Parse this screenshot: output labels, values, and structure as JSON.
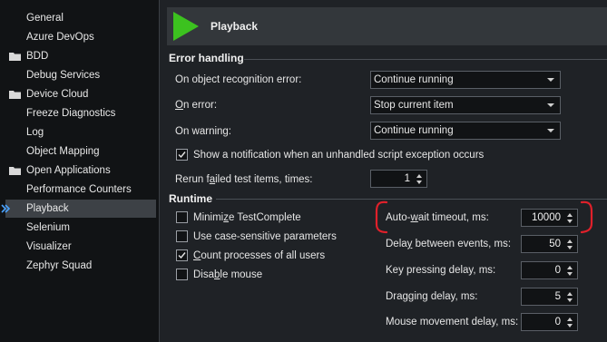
{
  "sidebar": {
    "items": [
      {
        "label": "General",
        "folder": false,
        "selected": false
      },
      {
        "label": "Azure DevOps",
        "folder": false,
        "selected": false
      },
      {
        "label": "BDD",
        "folder": true,
        "selected": false
      },
      {
        "label": "Debug Services",
        "folder": false,
        "selected": false
      },
      {
        "label": "Device Cloud",
        "folder": true,
        "selected": false
      },
      {
        "label": "Freeze Diagnostics",
        "folder": false,
        "selected": false
      },
      {
        "label": "Log",
        "folder": false,
        "selected": false
      },
      {
        "label": "Object Mapping",
        "folder": false,
        "selected": false
      },
      {
        "label": "Open Applications",
        "folder": true,
        "selected": false
      },
      {
        "label": "Performance Counters",
        "folder": false,
        "selected": false
      },
      {
        "label": "Playback",
        "folder": false,
        "selected": true
      },
      {
        "label": "Selenium",
        "folder": false,
        "selected": false
      },
      {
        "label": "Visualizer",
        "folder": false,
        "selected": false
      },
      {
        "label": "Zephyr Squad",
        "folder": false,
        "selected": false
      }
    ]
  },
  "header": {
    "title": "Playback",
    "icon": "play-icon",
    "icon_color": "#3cc21f"
  },
  "error_handling": {
    "title": "Error handling",
    "object_error": {
      "label": "On object recognition error:",
      "value": "Continue running"
    },
    "on_error": {
      "label_u": "O",
      "label_rest": "n error:",
      "value": "Stop current item"
    },
    "on_warning": {
      "label": "On warning:",
      "value": "Continue running"
    },
    "notify": {
      "label": "Show a notification when an unhandled script exception occurs",
      "checked": true
    },
    "rerun": {
      "label_a": "Rerun f",
      "label_u": "a",
      "label_b": "iled test items, times:",
      "value": "1"
    }
  },
  "runtime": {
    "title": "Runtime",
    "minimize": {
      "label_a": "Minimi",
      "label_u": "z",
      "label_b": "e TestComplete",
      "checked": false
    },
    "case_sensitive": {
      "label": "Use case-sensitive parameters",
      "checked": false
    },
    "count_processes": {
      "label_a": "",
      "label_u": "C",
      "label_b": "ount processes of all users",
      "checked": true
    },
    "disable_mouse": {
      "label_a": "Disa",
      "label_u": "b",
      "label_b": "le mouse",
      "checked": false
    },
    "auto_wait": {
      "label_a": "Auto-",
      "label_u": "w",
      "label_b": "ait timeout, ms:",
      "value": "10000"
    },
    "delay_events": {
      "label_a": "Dela",
      "label_u": "y",
      "label_b": " between events, ms:",
      "value": "50"
    },
    "key_delay": {
      "label": "Key pressing delay, ms:",
      "value": "0"
    },
    "drag_delay": {
      "label": "Dragging delay, ms:",
      "value": "5"
    },
    "mouse_delay": {
      "label": "Mouse movement delay, ms:",
      "value": "0"
    }
  },
  "annotation_color": "#e0202a"
}
